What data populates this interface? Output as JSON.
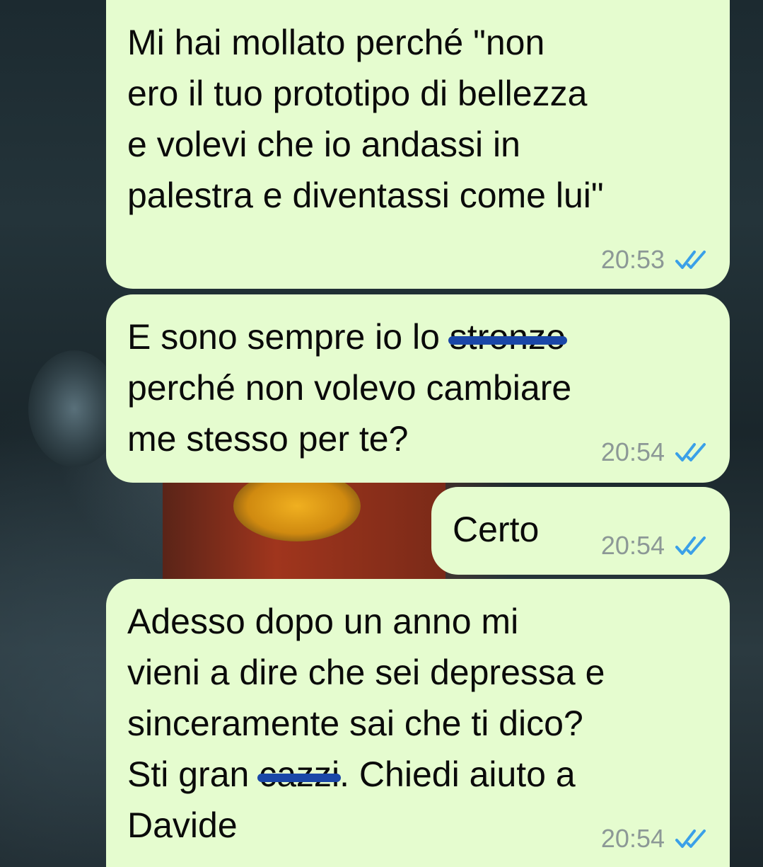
{
  "messages": [
    {
      "lines": [
        "Mi hai mollato perché \"non",
        "ero il tuo prototipo di bellezza",
        "e volevi che io andassi in",
        "palestra e diventassi come lui\""
      ],
      "time": "20:53",
      "status_icon": "double-check-read-icon"
    },
    {
      "line1_before": "E sono sempre io lo ",
      "line1_censored": "stronzo",
      "lines_after": [
        "perché non volevo cambiare",
        "me stesso per te?"
      ],
      "time": "20:54",
      "status_icon": "double-check-read-icon"
    },
    {
      "text": "Certo",
      "time": "20:54",
      "status_icon": "double-check-read-icon"
    },
    {
      "lines": [
        "Adesso dopo un anno mi",
        "vieni a dire che sei depressa e",
        "sinceramente sai che ti dico?"
      ],
      "line4_before": "Sti gran ",
      "line4_censored": "cazzi",
      "line4_after": ". Chiedi aiuto a",
      "line5": "Davide",
      "time": "20:54",
      "status_icon": "double-check-read-icon"
    }
  ],
  "colors": {
    "bubble": "#e5fccf",
    "tick": "#3aa0e8",
    "censor": "#1a47a8",
    "timestamp": "#8c9896"
  }
}
